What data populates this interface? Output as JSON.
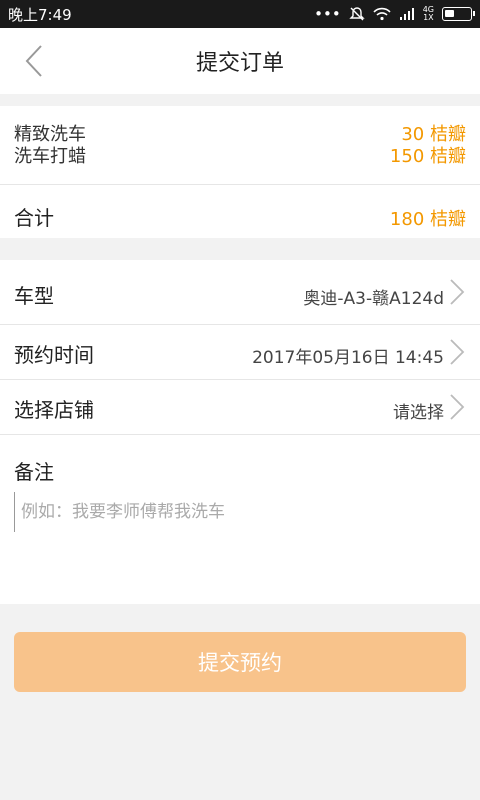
{
  "status_bar": {
    "time": "晚上7:49",
    "network": "4G",
    "network_sub": "1X"
  },
  "header": {
    "title": "提交订单"
  },
  "services": {
    "items": [
      {
        "name": "精致洗车",
        "price": "30 桔瓣"
      },
      {
        "name": "洗车打蜡",
        "price": "150 桔瓣"
      }
    ],
    "total_label": "合计",
    "total_value": "180 桔瓣"
  },
  "form": {
    "car_label": "车型",
    "car_value": "奥迪-A3-赣A124d",
    "time_label": "预约时间",
    "time_value": "2017年05月16日 14:45",
    "store_label": "选择店铺",
    "store_value": "请选择",
    "note_label": "备注",
    "note_placeholder": "例如：我要李师傅帮我洗车"
  },
  "submit_label": "提交预约",
  "colors": {
    "accent": "#f39800",
    "button": "#f8c38b"
  }
}
